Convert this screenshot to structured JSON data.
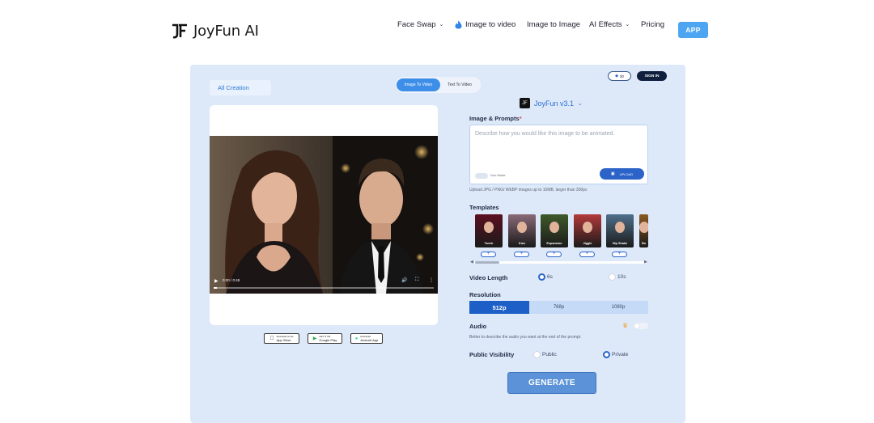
{
  "header": {
    "brand": "JoyFun AI",
    "nav": [
      {
        "label": "Face Swap",
        "icon": "chevron-down-icon"
      },
      {
        "label": "Image to video",
        "icon": "flame-icon"
      },
      {
        "label": "Image to Image"
      },
      {
        "label": "AI Effects",
        "icon": "chevron-down-icon"
      },
      {
        "label": "Pricing"
      }
    ],
    "app_button": "APP"
  },
  "panel": {
    "all_creation": "All Creation",
    "mode_tabs": [
      "Image To Video",
      "Text To Video"
    ],
    "credits": "30",
    "sign_in": "SIGN IN"
  },
  "video": {
    "time": "0:00 / 0:49",
    "progress": 0.0
  },
  "stores": [
    "App Store",
    "Google Play",
    "Android App"
  ],
  "store_captions": [
    "Download on the",
    "GET IT ON",
    "Download"
  ],
  "form": {
    "model": "JoyFun v3.1",
    "image_prompts_label": "Image & Prompts",
    "required_mark": "*",
    "prompt_placeholder": "Describe how you would like this image to be animated.",
    "duo_mode": "Duo Mode",
    "upload": "UPLOAD",
    "upload_hint": "Upload JPG / PNG/ WEBP images up to 10MB, larger than 300px",
    "templates_label": "Templates",
    "templates": [
      {
        "name": "Twerk",
        "color": "#5b1020"
      },
      {
        "name": "Kiss",
        "color": "#8a6a78"
      },
      {
        "name": "Expansion",
        "color": "#3f5a2a"
      },
      {
        "name": "Jiggle",
        "color": "#b33a3a"
      },
      {
        "name": "Hip Shake",
        "color": "#4f6f8a"
      },
      {
        "name": "Bo",
        "color": "#8a5a20"
      }
    ],
    "video_length_label": "Video Length",
    "video_length_options": [
      "6s",
      "10s"
    ],
    "video_length_selected": "6s",
    "resolution_label": "Resolution",
    "resolution_options": [
      "512p",
      "768p",
      "1080p"
    ],
    "resolution_selected": "512p",
    "audio_label": "Audio",
    "audio_on": false,
    "audio_hint": "Better to describe the audio you want at the end of the prompt.",
    "visibility_label": "Public Visibility",
    "visibility_options": [
      "Public",
      "Private"
    ],
    "visibility_selected": "Private",
    "generate": "GENERATE"
  },
  "colors": {
    "accent": "#2c63c9",
    "panel_bg": "#dde9f9",
    "app_button": "#4ea6f2"
  }
}
